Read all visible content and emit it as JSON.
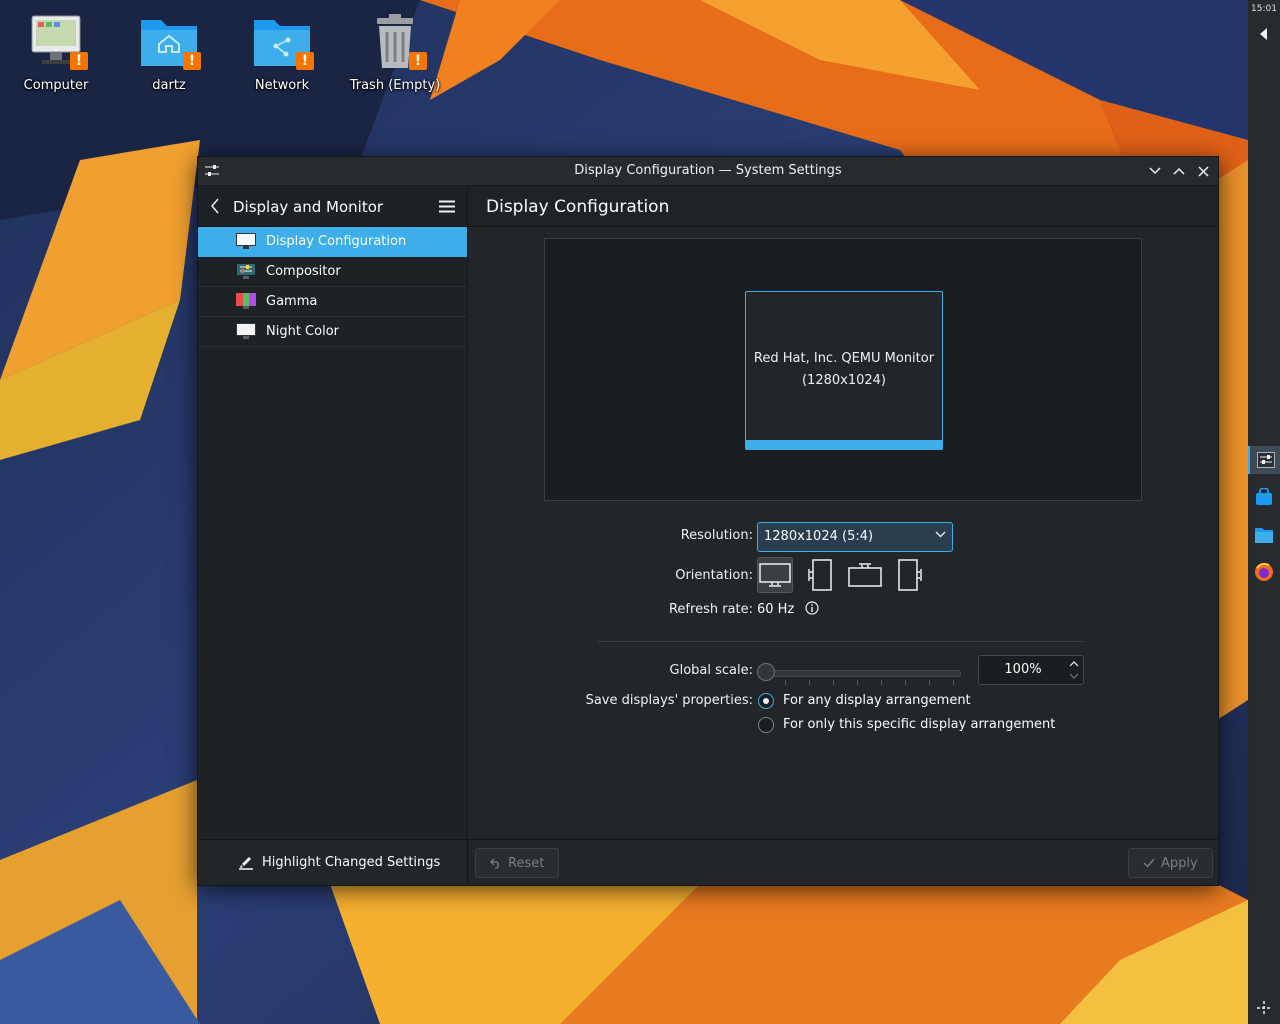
{
  "desktop": {
    "icons": [
      {
        "label": "Computer",
        "icon": "computer-icon"
      },
      {
        "label": "dartz",
        "icon": "home-folder-icon"
      },
      {
        "label": "Network",
        "icon": "network-folder-icon"
      },
      {
        "label": "Trash (Empty)",
        "icon": "trash-icon"
      }
    ]
  },
  "panel": {
    "clock": "15:01"
  },
  "window": {
    "title": "Display Configuration — System Settings",
    "sidebar": {
      "title": "Display and Monitor",
      "items": [
        {
          "label": "Display Configuration",
          "icon": "display-icon",
          "active": true
        },
        {
          "label": "Compositor",
          "icon": "compositor-icon"
        },
        {
          "label": "Gamma",
          "icon": "gamma-icon"
        },
        {
          "label": "Night Color",
          "icon": "night-color-icon"
        }
      ],
      "footer_button": "Highlight Changed Settings"
    },
    "main": {
      "title": "Display Configuration",
      "monitor": {
        "name": "Red Hat, Inc. QEMU Monitor",
        "resolution": "(1280x1024)"
      },
      "resolution_label": "Resolution:",
      "resolution_value": "1280x1024 (5:4)",
      "orientation_label": "Orientation:",
      "refresh_label": "Refresh rate:",
      "refresh_value": "60 Hz",
      "scale_label": "Global scale:",
      "scale_value": "100%",
      "scale_level": 0,
      "save_label": "Save displays' properties:",
      "save_options": [
        "For any display arrangement",
        "For only this specific display arrangement"
      ],
      "save_selected": 0,
      "reset_label": "Reset",
      "apply_label": "Apply"
    }
  },
  "colors": {
    "accent": "#3daee9",
    "warning": "#f67400",
    "window_bg": "#232629"
  }
}
